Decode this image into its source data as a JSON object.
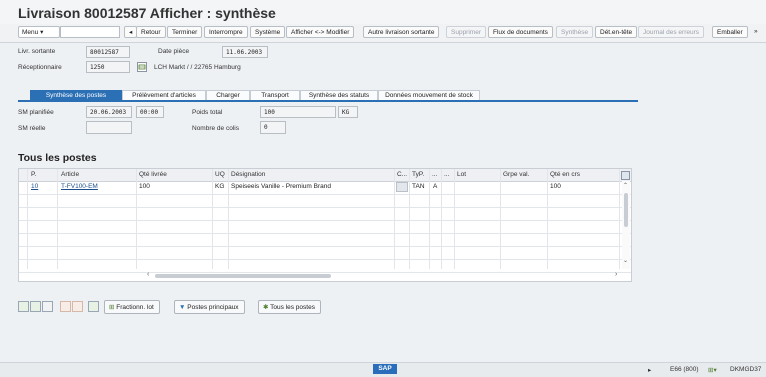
{
  "title": "Livraison 80012587 Afficher : synthèse",
  "toolbar": {
    "menu": "Menu",
    "buttons": [
      "Retour",
      "Terminer",
      "Interrompre",
      "Système",
      "Afficher <-> Modifier",
      "Autre livraison sortante",
      "Supprimer",
      "Flux de documents",
      "Synthèse",
      "Dét.en-tête",
      "Journal des erreurs",
      "Emballer"
    ],
    "more": "»"
  },
  "header": {
    "livr_sortante_label": "Livr. sortante",
    "livr_sortante_value": "80012587",
    "date_piece_label": "Date pièce",
    "date_piece_value": "11.06.2003",
    "receptionnaire_label": "Réceptionnaire",
    "receptionnaire_value": "1250",
    "receptionnaire_name": "LCH Markt / / 22765 Hamburg"
  },
  "tabs": [
    "Synthèse des postes",
    "Prélèvement d'articles",
    "Charger",
    "Transport",
    "Synthèse des statuts",
    "Données mouvement de stock"
  ],
  "summary": {
    "sm_planifiee_label": "SM planifiée",
    "sm_planifiee_date": "20.06.2003",
    "sm_planifiee_time": "00:00",
    "sm_reelle_label": "SM réelle",
    "poids_total_label": "Poids total",
    "poids_total_value": "100",
    "poids_unit": "KG",
    "nombre_colis_label": "Nombre de colis",
    "nombre_colis_value": "0"
  },
  "section_title": "Tous les postes",
  "table": {
    "columns": [
      "P.",
      "Article",
      "Qté livrée",
      "UQ",
      "Désignation",
      "C...",
      "TyP.",
      "...",
      "...",
      "Lot",
      "Grpe val.",
      "Qté en crs"
    ],
    "rows": [
      [
        "10",
        "T-FV100-EM",
        "100",
        "KG",
        "Speiseeis  Vanille - Premium Brand",
        "",
        "TAN",
        "A",
        "",
        "",
        "",
        "100"
      ]
    ]
  },
  "bottom_buttons": {
    "fractionn": "Fractionn. lot",
    "postes_principaux": "Postes principaux",
    "tous_les_postes": "Tous les postes"
  },
  "status_bar": {
    "logo": "SAP",
    "system": "E66 (800)",
    "server": "DKMGD37"
  },
  "colors": {
    "tab_active": "#2b6fb5",
    "link": "#1b4f8c",
    "sap_blue": "#2a6ebb"
  }
}
